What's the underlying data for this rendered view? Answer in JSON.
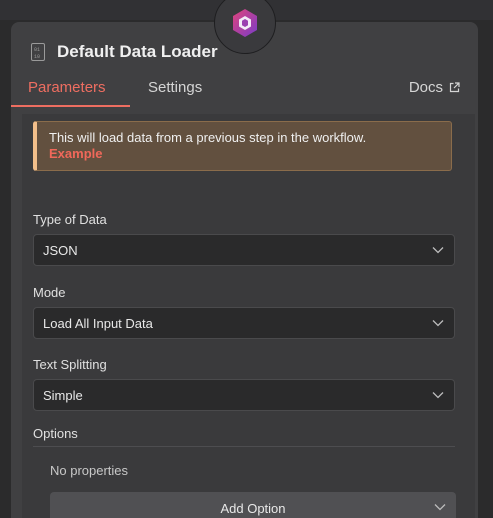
{
  "node": {
    "title": "Default Data Loader",
    "icon": "document-icon",
    "badge_icon": "logo-icon"
  },
  "tabs": {
    "parameters": "Parameters",
    "settings": "Settings",
    "docs": "Docs",
    "active": "Parameters"
  },
  "notice": {
    "text": "This will load data from a previous step in the workflow.",
    "link": "Example"
  },
  "fields": {
    "type_of_data": {
      "label": "Type of Data",
      "value": "JSON"
    },
    "mode": {
      "label": "Mode",
      "value": "Load All Input Data"
    },
    "text_splitting": {
      "label": "Text Splitting",
      "value": "Simple"
    }
  },
  "options": {
    "heading": "Options",
    "empty_text": "No properties",
    "add_label": "Add Option"
  },
  "colors": {
    "accent": "#ee6e61",
    "notice_bg": "#62503f",
    "notice_border": "#f2bf8b",
    "panel_bg": "#404042"
  }
}
